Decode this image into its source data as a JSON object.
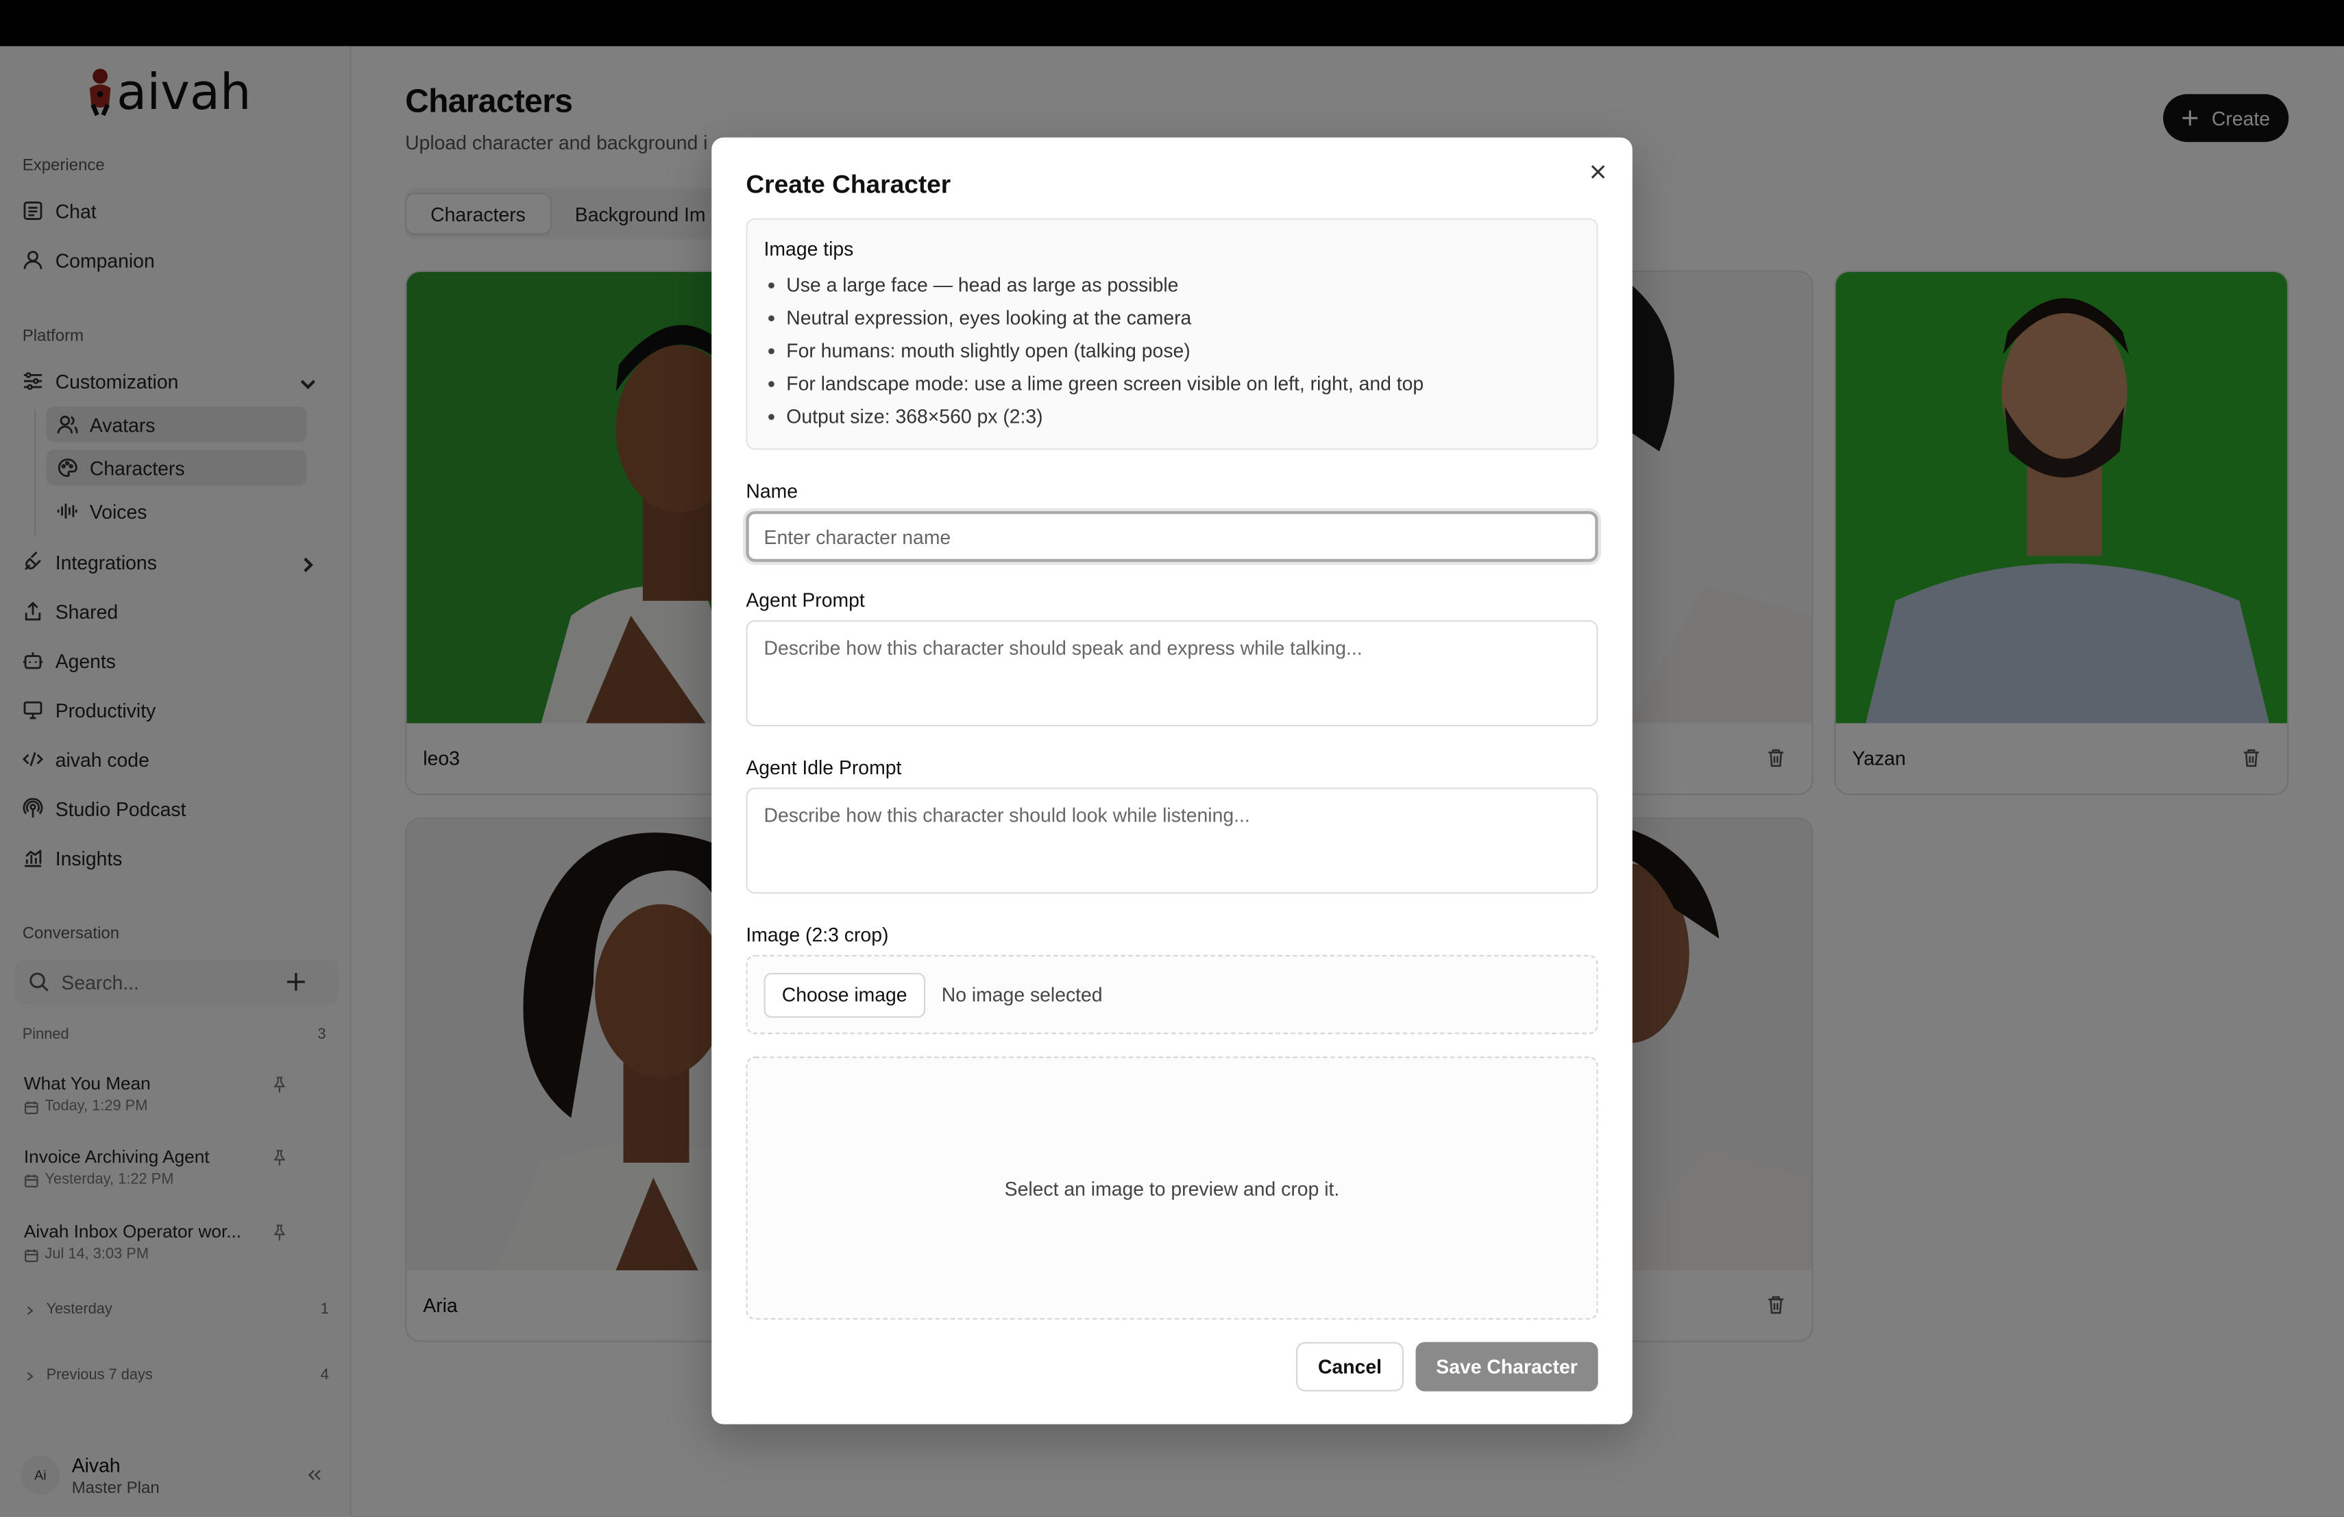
{
  "brand": {
    "name": "aivah"
  },
  "sidebar": {
    "experience_label": "Experience",
    "experience_items": [
      {
        "label": "Chat",
        "icon": "chat-icon"
      },
      {
        "label": "Companion",
        "icon": "user-icon"
      }
    ],
    "platform_label": "Platform",
    "customization": {
      "label": "Customization",
      "sub_items": [
        {
          "label": "Avatars",
          "icon": "users-icon",
          "active": true
        },
        {
          "label": "Characters",
          "icon": "palette-icon",
          "active": true
        },
        {
          "label": "Voices",
          "icon": "audio-wave-icon",
          "active": false
        }
      ]
    },
    "platform_items": [
      {
        "label": "Integrations",
        "icon": "plug-icon"
      },
      {
        "label": "Shared",
        "icon": "share-icon"
      },
      {
        "label": "Agents",
        "icon": "bot-icon"
      },
      {
        "label": "Productivity",
        "icon": "monitor-icon"
      },
      {
        "label": "aivah code",
        "icon": "code-icon"
      },
      {
        "label": "Studio Podcast",
        "icon": "podcast-icon"
      },
      {
        "label": "Insights",
        "icon": "chart-icon"
      }
    ],
    "conversation_label": "Conversation",
    "search_placeholder": "Search...",
    "pinned_label": "Pinned",
    "pinned_count": "3",
    "pinned": [
      {
        "title": "What You Mean",
        "date": "Today, 1:29 PM"
      },
      {
        "title": "Invoice Archiving Agent",
        "date": "Yesterday, 1:22 PM"
      },
      {
        "title": "Aivah Inbox Operator wor...",
        "date": "Jul 14, 3:03 PM"
      }
    ],
    "groups": [
      {
        "label": "Yesterday",
        "count": "1"
      },
      {
        "label": "Previous 7 days",
        "count": "4"
      }
    ],
    "user": {
      "initials": "Ai",
      "name": "Aivah",
      "plan": "Master Plan"
    }
  },
  "main": {
    "title": "Characters",
    "subtitle": "Upload character and background i",
    "create_label": "Create",
    "tabs": [
      {
        "label": "Characters"
      },
      {
        "label": "Background Im"
      }
    ],
    "cards": [
      {
        "name": "leo3"
      },
      {
        "name": "Yazan"
      },
      {
        "name": "Aria"
      }
    ]
  },
  "modal": {
    "title": "Create Character",
    "tips_title": "Image tips",
    "tips": [
      "Use a large face — head as large as possible",
      "Neutral expression, eyes looking at the camera",
      "For humans: mouth slightly open (talking pose)",
      "For landscape mode: use a lime green screen visible on left, right, and top",
      "Output size: 368×560 px (2:3)"
    ],
    "name_label": "Name",
    "name_placeholder": "Enter character name",
    "agent_prompt_label": "Agent Prompt",
    "agent_prompt_placeholder": "Describe how this character should speak and express while talking...",
    "idle_prompt_label": "Agent Idle Prompt",
    "idle_prompt_placeholder": "Describe how this character should look while listening...",
    "image_label": "Image (2:3 crop)",
    "choose_label": "Choose image",
    "no_image_text": "No image selected",
    "preview_text": "Select an image to preview and crop it.",
    "cancel_label": "Cancel",
    "save_label": "Save Character"
  },
  "colors": {
    "green_screen": "#2e9a2e",
    "dark_button": "#111111",
    "save_disabled": "#8a8a8a",
    "overlay": "rgba(0,0,0,0.5)"
  }
}
